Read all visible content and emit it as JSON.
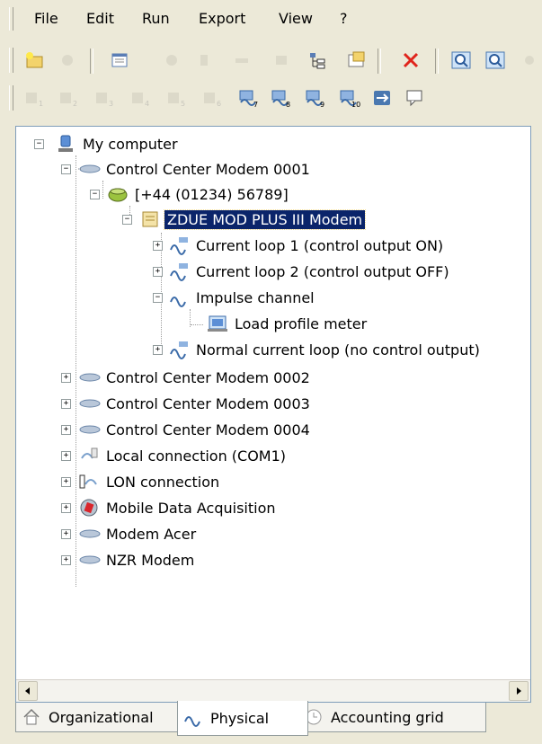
{
  "menu": {
    "items": [
      "File",
      "Edit",
      "Run",
      "Export",
      "View",
      "?"
    ]
  },
  "tree": {
    "root": "My computer",
    "nodes": [
      "Control Center Modem 0001",
      "[+44 (01234) 56789]",
      "ZDUE MOD PLUS III Modem",
      "Current loop 1 (control output ON)",
      "Current loop 2 (control output OFF)",
      "Impulse channel",
      "Load profile meter",
      "Normal current loop (no control output)",
      "Control Center Modem 0002",
      "Control Center Modem 0003",
      "Control Center Modem 0004",
      "Local connection (COM1)",
      "LON connection",
      "Mobile Data Acquisition",
      "Modem Acer",
      "NZR Modem"
    ]
  },
  "toolbar2": {
    "channel_digits": [
      "1",
      "2",
      "3",
      "4",
      "5",
      "6",
      "7",
      "8",
      "9",
      "10"
    ]
  },
  "tabs": {
    "organizational": "Organizational",
    "physical": "Physical",
    "accounting": "Accounting grid"
  },
  "colors": {
    "selection": "#0a246a",
    "window_bg": "#ece9d8",
    "delete_red": "#e0241b"
  }
}
